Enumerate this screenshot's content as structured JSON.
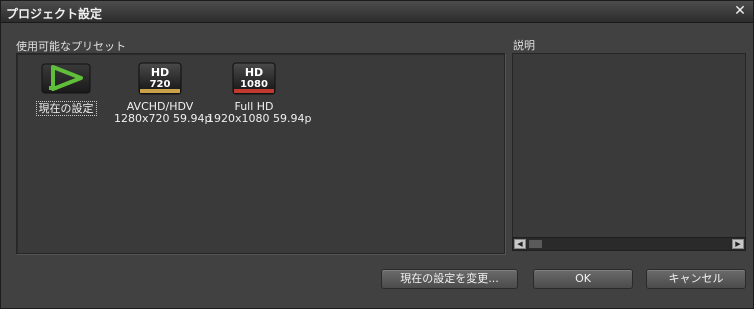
{
  "window": {
    "title": "プロジェクト設定",
    "close_glyph": "✕"
  },
  "presets_section": {
    "label": "使用可能なプリセット",
    "items": [
      {
        "name": "現在の設定",
        "resolution": "",
        "icon": "current-settings-icon",
        "selected": true
      },
      {
        "name": "AVCHD/HDV",
        "resolution": "1280x720 59.94p",
        "icon": "hd720-icon",
        "badge_top": "HD",
        "badge_bottom": "720"
      },
      {
        "name": "Full HD",
        "resolution": "1920x1080 59.94p",
        "icon": "hd1080-icon",
        "badge_top": "HD",
        "badge_bottom": "1080"
      }
    ]
  },
  "description_section": {
    "label": "説明",
    "text": ""
  },
  "scrollbar": {
    "left_glyph": "◀",
    "right_glyph": "▶"
  },
  "buttons": {
    "change": "現在の設定を変更...",
    "ok": "OK",
    "cancel": "キャンセル"
  },
  "colors": {
    "accent_green": "#5fbf3a",
    "hd720_bar": "#c9a24a",
    "hd1080_bar": "#c23a2e"
  }
}
